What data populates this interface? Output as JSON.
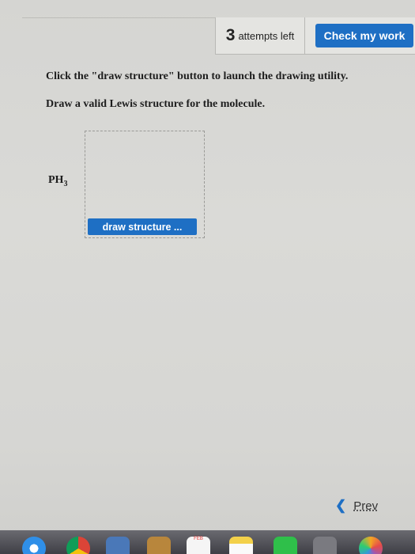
{
  "header": {
    "attempts_count": "3",
    "attempts_label": "attempts left",
    "check_button_label": "Check my work"
  },
  "question": {
    "instruction_1": "Click the \"draw structure\" button to launch the drawing utility.",
    "instruction_2": "Draw a valid Lewis structure for the molecule.",
    "molecule_main": "PH",
    "molecule_sub": "3",
    "draw_button_label": "draw structure ..."
  },
  "navigation": {
    "prev_label": "Prev"
  },
  "dock": {
    "calendar_month": "FEB"
  },
  "colors": {
    "accent": "#1e6fc4",
    "page_background": "#d8d8d5"
  },
  "icons": {
    "prev": "chevron-left-icon"
  }
}
